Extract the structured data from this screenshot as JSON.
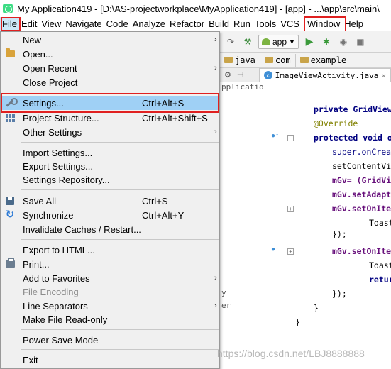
{
  "window": {
    "title": "My Application419 - [D:\\AS-projectworkplace\\MyApplication419] - [app] - ...\\app\\src\\main\\"
  },
  "menubar": {
    "items": [
      "File",
      "Edit",
      "View",
      "Navigate",
      "Code",
      "Analyze",
      "Refactor",
      "Build",
      "Run",
      "Tools",
      "VCS",
      "Window",
      "Help"
    ]
  },
  "toolbar": {
    "run_config": "app"
  },
  "breadcrumb": [
    "java",
    "com",
    "example"
  ],
  "editor_tab": {
    "filename": "ImageViewActivity.java",
    "close": "×"
  },
  "project_panel": {
    "lines": [
      "pplicatio",
      "y",
      "er"
    ]
  },
  "file_menu": {
    "items": [
      {
        "label": "New",
        "shortcut": "",
        "submenu": true,
        "icon": "none"
      },
      {
        "label": "Open...",
        "shortcut": "",
        "submenu": false,
        "icon": "folder-icon"
      },
      {
        "label": "Open Recent",
        "shortcut": "",
        "submenu": true,
        "icon": "none"
      },
      {
        "label": "Close Project",
        "shortcut": "",
        "submenu": false,
        "icon": "none"
      },
      {
        "label": "Settings...",
        "shortcut": "Ctrl+Alt+S",
        "submenu": false,
        "icon": "wrench-icon",
        "selected": true
      },
      {
        "label": "Project Structure...",
        "shortcut": "Ctrl+Alt+Shift+S",
        "submenu": false,
        "icon": "project-structure-icon"
      },
      {
        "label": "Other Settings",
        "shortcut": "",
        "submenu": true,
        "icon": "none"
      },
      {
        "label": "Import Settings...",
        "shortcut": "",
        "submenu": false,
        "icon": "none"
      },
      {
        "label": "Export Settings...",
        "shortcut": "",
        "submenu": false,
        "icon": "none"
      },
      {
        "label": "Settings Repository...",
        "shortcut": "",
        "submenu": false,
        "icon": "none"
      },
      {
        "label": "Save All",
        "shortcut": "Ctrl+S",
        "submenu": false,
        "icon": "save-icon"
      },
      {
        "label": "Synchronize",
        "shortcut": "Ctrl+Alt+Y",
        "submenu": false,
        "icon": "sync-icon"
      },
      {
        "label": "Invalidate Caches / Restart...",
        "shortcut": "",
        "submenu": false,
        "icon": "none"
      },
      {
        "label": "Export to HTML...",
        "shortcut": "",
        "submenu": false,
        "icon": "none"
      },
      {
        "label": "Print...",
        "shortcut": "",
        "submenu": false,
        "icon": "print-icon"
      },
      {
        "label": "Add to Favorites",
        "shortcut": "",
        "submenu": true,
        "icon": "none"
      },
      {
        "label": "File Encoding",
        "shortcut": "",
        "submenu": false,
        "icon": "none",
        "disabled": true
      },
      {
        "label": "Line Separators",
        "shortcut": "",
        "submenu": true,
        "icon": "none"
      },
      {
        "label": "Make File Read-only",
        "shortcut": "",
        "submenu": false,
        "icon": "none"
      },
      {
        "label": "Power Save Mode",
        "shortcut": "",
        "submenu": false,
        "icon": "none"
      },
      {
        "label": "Exit",
        "shortcut": "",
        "submenu": false,
        "icon": "none"
      }
    ]
  },
  "code": {
    "lines": [
      "private GridView",
      "@Override",
      "protected void o",
      "super.onCreat",
      "setContentVie",
      "mGv= (GridVie",
      "mGv.setAdapte",
      "mGv.setOnItem",
      "Toast",
      "});",
      "mGv.setOnItem",
      "Toast",
      "retur",
      "});",
      "}",
      "}"
    ]
  },
  "watermark": "https://blog.csdn.net/LBJ8888888",
  "colors": {
    "highlight_box": "#e02020",
    "selected_item": "#9fd0f5",
    "keyword": "#000080",
    "annotation": "#808000",
    "field": "#660e7a"
  }
}
